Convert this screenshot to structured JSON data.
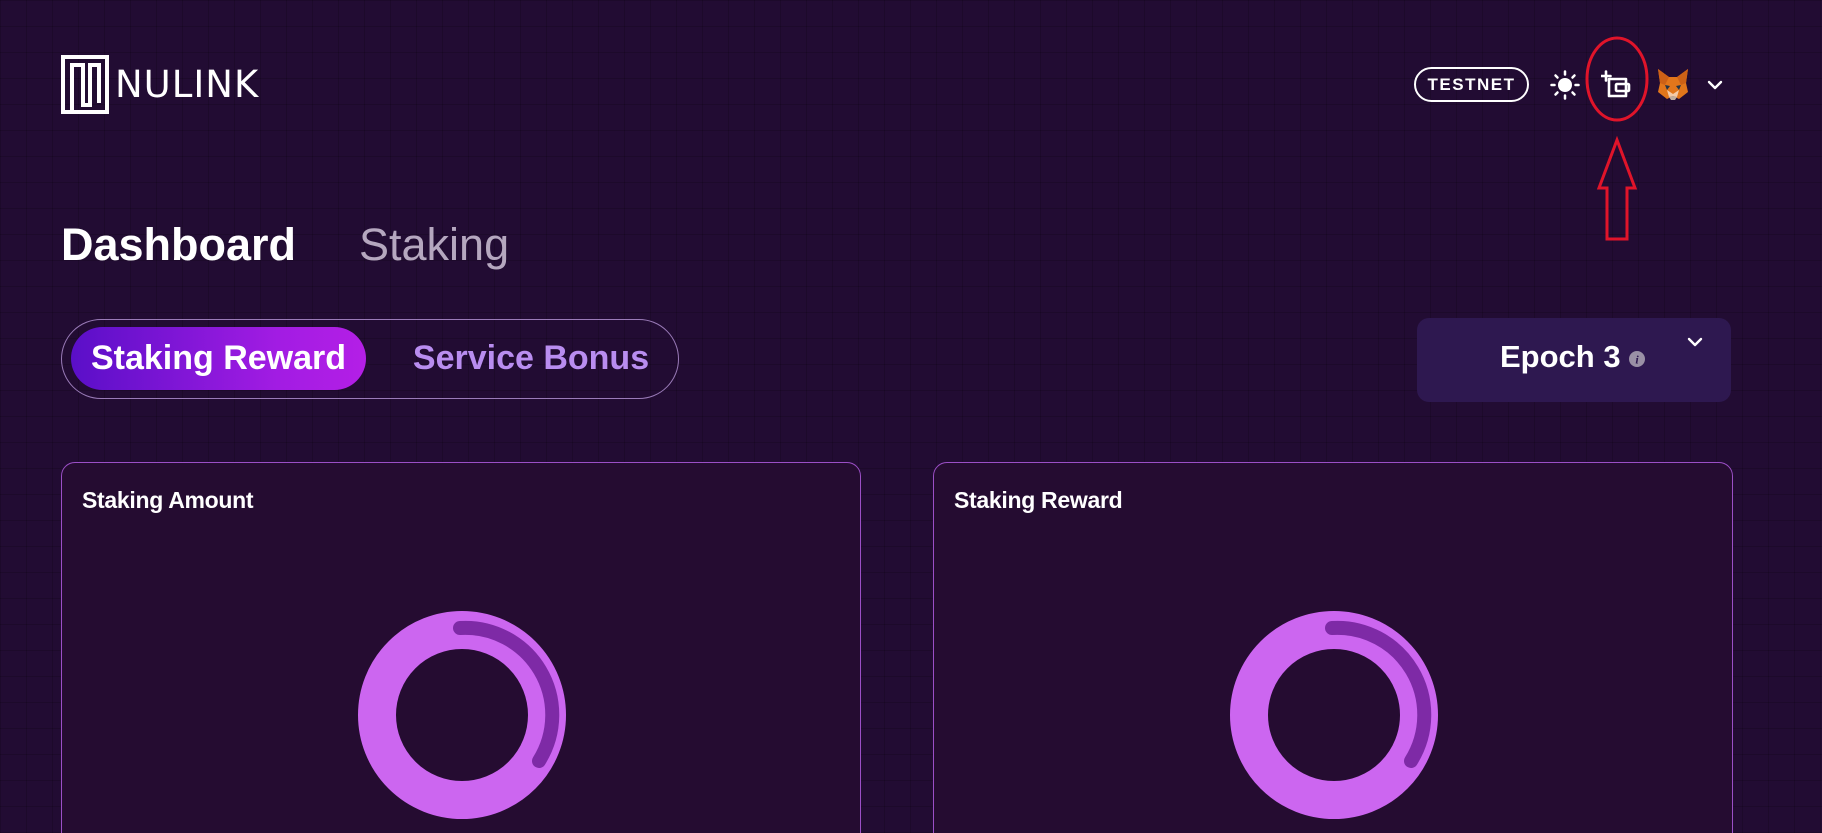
{
  "header": {
    "logo_text": "NULINK",
    "network_badge": "TESTNET",
    "icons": {
      "theme": "sun-icon",
      "wallet": "add-wallet-icon",
      "account": "metamask-fox-icon",
      "menu": "chevron-down-icon"
    }
  },
  "annotation": {
    "shape": "red-ellipse-and-up-arrow",
    "color": "#e0142a"
  },
  "nav": {
    "tabs": [
      {
        "label": "Dashboard",
        "active": true
      },
      {
        "label": "Staking",
        "active": false
      }
    ]
  },
  "reward_toggle": {
    "options": [
      {
        "label": "Staking Reward",
        "active": true
      },
      {
        "label": "Service Bonus",
        "active": false
      }
    ]
  },
  "epoch_select": {
    "label": "Epoch 3",
    "info_icon": "info-icon"
  },
  "cards": [
    {
      "title": "Staking Amount",
      "chart": "donut"
    },
    {
      "title": "Staking Reward",
      "chart": "donut"
    }
  ],
  "colors": {
    "background": "#220c33",
    "accent_gradient_start": "#5a0fc8",
    "accent_gradient_end": "#b41fe6",
    "donut_main": "#cc66f0",
    "donut_arc": "#7e2aa6",
    "card_border": "#9b4fc6",
    "inactive_segment_text": "#b98df0"
  }
}
